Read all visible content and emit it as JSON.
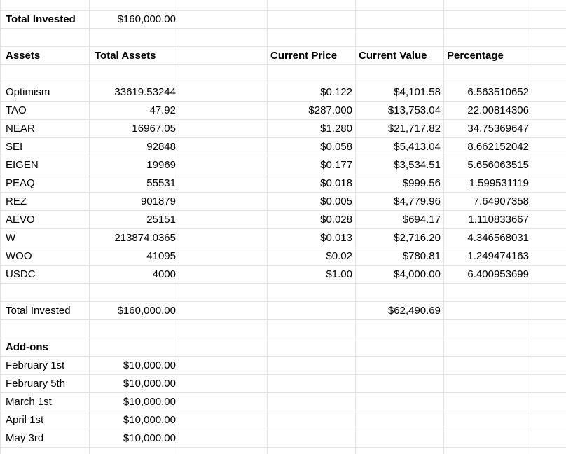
{
  "top": {
    "label": "Total Invested",
    "value": "$160,000.00"
  },
  "headers": {
    "assets": "Assets",
    "total_assets": "Total Assets",
    "current_price": "Current Price",
    "current_value": "Current Value",
    "percentage": "Percentage"
  },
  "rows": [
    {
      "asset": "Optimism",
      "amount": "33619.53244",
      "price": "$0.122",
      "value": "$4,101.58",
      "pct": "6.563510652"
    },
    {
      "asset": "TAO",
      "amount": "47.92",
      "price": "$287.000",
      "value": "$13,753.04",
      "pct": "22.00814306"
    },
    {
      "asset": "NEAR",
      "amount": "16967.05",
      "price": "$1.280",
      "value": "$21,717.82",
      "pct": "34.75369647"
    },
    {
      "asset": "SEI",
      "amount": "92848",
      "price": "$0.058",
      "value": "$5,413.04",
      "pct": "8.662152042"
    },
    {
      "asset": "EIGEN",
      "amount": "19969",
      "price": "$0.177",
      "value": "$3,534.51",
      "pct": "5.656063515"
    },
    {
      "asset": "PEAQ",
      "amount": "55531",
      "price": "$0.018",
      "value": "$999.56",
      "pct": "1.599531119"
    },
    {
      "asset": "REZ",
      "amount": "901879",
      "price": "$0.005",
      "value": "$4,779.96",
      "pct": "7.64907358"
    },
    {
      "asset": "AEVO",
      "amount": "25151",
      "price": "$0.028",
      "value": "$694.17",
      "pct": "1.110833667"
    },
    {
      "asset": "W",
      "amount": "213874.0365",
      "price": "$0.013",
      "value": "$2,716.20",
      "pct": "4.346568031"
    },
    {
      "asset": "WOO",
      "amount": "41095",
      "price": "$0.02",
      "value": "$780.81",
      "pct": "1.249474163"
    },
    {
      "asset": "USDC",
      "amount": "4000",
      "price": "$1.00",
      "value": "$4,000.00",
      "pct": "6.400953699"
    }
  ],
  "total_row": {
    "label": "Total Invested",
    "invested": "$160,000.00",
    "current_value": "$62,490.69"
  },
  "addons": {
    "title": "Add-ons",
    "items": [
      {
        "date": "February 1st",
        "amount": "$10,000.00"
      },
      {
        "date": "February 5th",
        "amount": "$10,000.00"
      },
      {
        "date": "March 1st",
        "amount": "$10,000.00"
      },
      {
        "date": "April 1st",
        "amount": "$10,000.00"
      },
      {
        "date": "May 3rd",
        "amount": "$10,000.00"
      }
    ]
  }
}
